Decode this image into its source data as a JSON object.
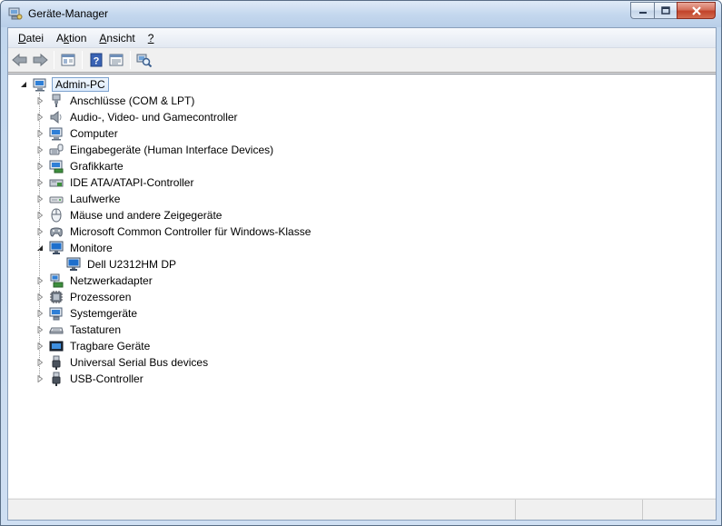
{
  "window": {
    "title": "Geräte-Manager"
  },
  "menu": [
    {
      "label": "Datei",
      "underline": "D",
      "rest": "atei"
    },
    {
      "label": "Aktion",
      "pre": "A",
      "underline": "k",
      "rest": "tion"
    },
    {
      "label": "Ansicht",
      "underline": "A",
      "rest": "nsicht"
    },
    {
      "label": "?",
      "underline": "?",
      "rest": ""
    }
  ],
  "toolbar": {
    "buttons": [
      "back-icon",
      "forward-icon",
      "show-hide-console-tree-icon",
      "help-icon",
      "properties-icon",
      "scan-hardware-icon"
    ]
  },
  "tree": {
    "root": {
      "label": "Admin-PC",
      "icon": "computer-icon",
      "expanded": true
    },
    "items": [
      {
        "label": "Anschlüsse (COM & LPT)",
        "icon": "port-icon"
      },
      {
        "label": "Audio-, Video- und Gamecontroller",
        "icon": "speaker-icon"
      },
      {
        "label": "Computer",
        "icon": "computer-icon"
      },
      {
        "label": "Eingabegeräte (Human Interface Devices)",
        "icon": "hid-icon"
      },
      {
        "label": "Grafikkarte",
        "icon": "display-adapter-icon"
      },
      {
        "label": "IDE ATA/ATAPI-Controller",
        "icon": "ide-controller-icon"
      },
      {
        "label": "Laufwerke",
        "icon": "disk-drive-icon"
      },
      {
        "label": "Mäuse und andere Zeigegeräte",
        "icon": "mouse-icon"
      },
      {
        "label": "Microsoft Common Controller für Windows-Klasse",
        "icon": "gamepad-icon"
      },
      {
        "label": "Monitore",
        "icon": "monitor-icon",
        "expanded": true,
        "children": [
          {
            "label": "Dell U2312HM DP",
            "icon": "monitor-icon"
          }
        ]
      },
      {
        "label": "Netzwerkadapter",
        "icon": "network-adapter-icon"
      },
      {
        "label": "Prozessoren",
        "icon": "processor-icon"
      },
      {
        "label": "Systemgeräte",
        "icon": "system-device-icon"
      },
      {
        "label": "Tastaturen",
        "icon": "keyboard-icon"
      },
      {
        "label": "Tragbare Geräte",
        "icon": "portable-device-icon"
      },
      {
        "label": "Universal Serial Bus devices",
        "icon": "usb-icon"
      },
      {
        "label": "USB-Controller",
        "icon": "usb-icon"
      }
    ]
  },
  "colors": {
    "selection_border": "#7da2ce",
    "title_gradient_top": "#dfeaf7",
    "close_button": "#c2432a"
  }
}
